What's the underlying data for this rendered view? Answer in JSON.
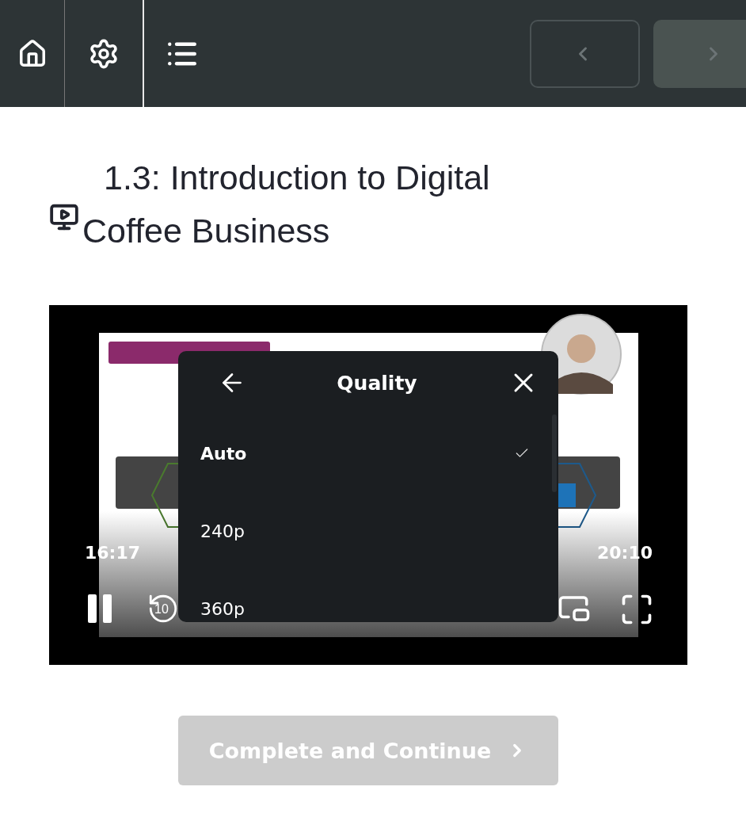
{
  "header": {
    "nav_buttons": [
      {
        "kind": "previous"
      },
      {
        "kind": "next"
      }
    ]
  },
  "lesson": {
    "title": "1.3: Introduction to Digital Coffee Business"
  },
  "player": {
    "current_time": "16:17",
    "duration": "20:10",
    "rewind_label": "10",
    "quality_menu": {
      "title": "Quality",
      "options": [
        {
          "label": "Auto",
          "selected": true
        },
        {
          "label": "240p",
          "selected": false
        },
        {
          "label": "360p",
          "selected": false
        }
      ]
    }
  },
  "complete_button": {
    "label": "Complete and Continue",
    "disabled": true
  }
}
